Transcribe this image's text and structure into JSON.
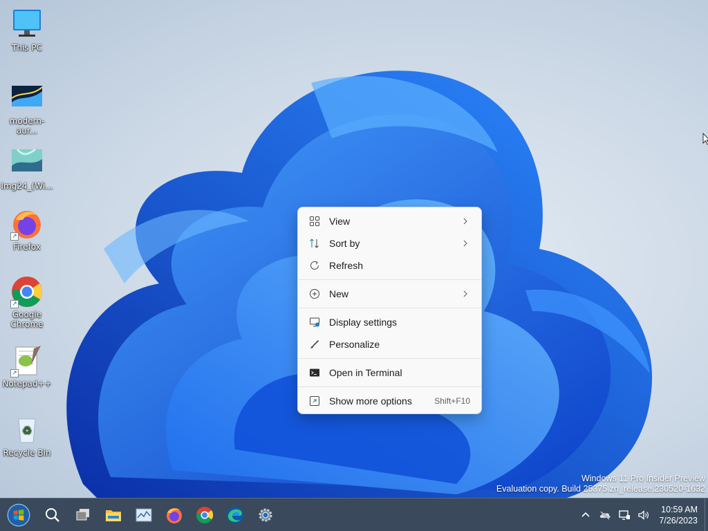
{
  "desktop": {
    "icons": [
      {
        "label": "This PC"
      },
      {
        "label": "modern-aur..."
      },
      {
        "label": "Img24_(Wi..."
      },
      {
        "label": "Firefox"
      },
      {
        "label": "Google Chrome"
      },
      {
        "label": "Notepad++"
      },
      {
        "label": "Recycle Bin"
      }
    ]
  },
  "context_menu": {
    "items": [
      {
        "label": "View",
        "icon": "grid-icon",
        "submenu": true
      },
      {
        "label": "Sort by",
        "icon": "sort-icon",
        "submenu": true
      },
      {
        "label": "Refresh",
        "icon": "refresh-icon"
      },
      {
        "label": "New",
        "icon": "plus-circle-icon",
        "submenu": true
      },
      {
        "label": "Display settings",
        "icon": "display-icon"
      },
      {
        "label": "Personalize",
        "icon": "brush-icon"
      },
      {
        "label": "Open in Terminal",
        "icon": "terminal-icon"
      },
      {
        "label": "Show more options",
        "icon": "more-options-icon",
        "shortcut": "Shift+F10"
      }
    ]
  },
  "watermark": {
    "line1": "Windows 11 Pro Insider Preview",
    "line2": "Evaluation copy. Build 25375.zn_release.230520-1632"
  },
  "taskbar": {
    "pinned": [
      "start-orb",
      "search-icon",
      "task-view-icon",
      "file-explorer-icon",
      "task-manager-icon",
      "firefox-icon",
      "chrome-icon",
      "edge-icon",
      "settings-icon"
    ],
    "tray": [
      "chevron-up-icon",
      "cloud-offline-icon",
      "network-icon",
      "volume-icon"
    ],
    "clock": {
      "time": "10:59 AM",
      "date": "7/26/2023"
    }
  },
  "colors": {
    "taskbar": "#3a4a5c",
    "menu_bg": "#f9f9f9",
    "accent": "#0067c0"
  }
}
